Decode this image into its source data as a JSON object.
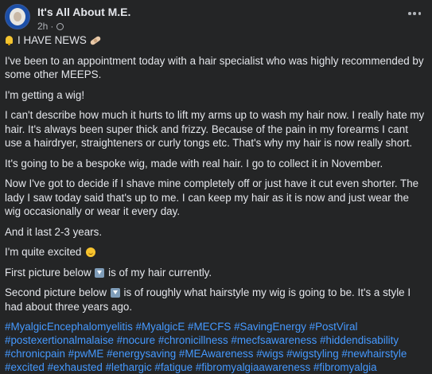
{
  "header": {
    "page_name": "It's All About M.E.",
    "time": "2h",
    "separator": "·"
  },
  "post": {
    "headline": "I HAVE NEWS",
    "p1": "I've been to an appointment today with a hair specialist who was highly recommended by some other MEEPS.",
    "p2": "I'm getting a wig!",
    "p3": "I can't describe how much it hurts to lift my arms up to wash my hair now. I really hate my hair. It's always been super thick and frizzy. Because of the pain in my forearms I cant use a hairdryer, straighteners or curly tongs etc. That's why my hair is now really short.",
    "p4": "It's going to be a bespoke wig, made with real hair. I go to collect it in November.",
    "p5": "Now I've got to decide if I shave mine completely off or just have it cut even shorter. The lady I saw today said that's up to me. I can keep my hair as it is now and just wear the wig occasionally or wear it every day.",
    "p6": "And it last 2-3 years.",
    "p7": "I'm quite excited",
    "p8_before": "First picture below",
    "p8_after": "is of my hair currently.",
    "p9_before": "Second picture below",
    "p9_after": "is of roughly what hairstyle my wig is going to be. It's a style I had about three years ago."
  },
  "hashtags": [
    "#MyalgicEncephalomyelitis",
    "#MyalgicE",
    "#MECFS",
    "#SavingEnergy",
    "#PostViral",
    "#postexertionalmalaise",
    "#nocure",
    "#chronicillness",
    "#mecfsawareness",
    "#hiddendisability",
    "#chronicpain",
    "#pwME",
    "#energysaving",
    "#MEAwareness",
    "#wigs",
    "#wigstyling",
    "#newhairstyle",
    "#excited",
    "#exhausted",
    "#lethargic",
    "#fatigue",
    "#fibromyalgiaawareness",
    "#fibromyalgia"
  ],
  "icons": {
    "headline_left": "bell-icon",
    "headline_right": "bandage-icon",
    "excited": "smiling-face-icon",
    "arrow": "down-arrow-icon",
    "menu": "more-options-icon",
    "audience": "globe-icon"
  }
}
